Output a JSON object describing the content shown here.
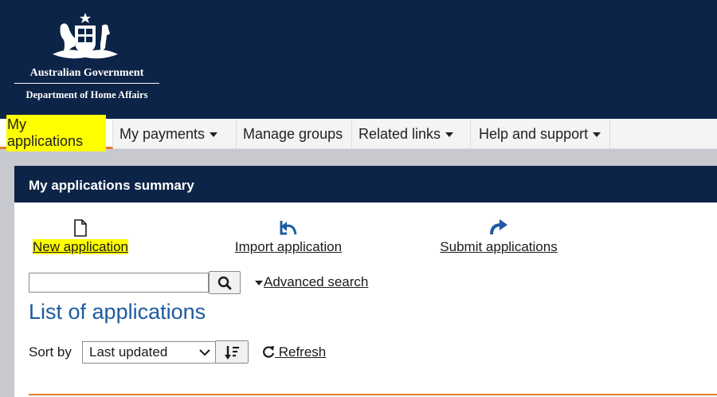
{
  "header": {
    "gov_line1": "Australian Government",
    "gov_line2": "Department of Home Affairs",
    "crest_icon": "commonwealth-coat-of-arms-icon"
  },
  "nav": {
    "items": [
      {
        "label": "My applications",
        "active": true,
        "dropdown": false
      },
      {
        "label": "My payments",
        "active": false,
        "dropdown": true
      },
      {
        "label": "Manage groups",
        "active": false,
        "dropdown": false
      },
      {
        "label": "Related links",
        "active": false,
        "dropdown": true
      },
      {
        "label": "Help and support",
        "active": false,
        "dropdown": true
      }
    ]
  },
  "panel": {
    "title": "My applications summary",
    "actions": {
      "new": {
        "label": "New application",
        "icon": "document-icon"
      },
      "import": {
        "label": "Import application",
        "icon": "import-arrow-icon"
      },
      "submit": {
        "label": "Submit applications",
        "icon": "forward-arrow-icon"
      }
    },
    "search": {
      "value": "",
      "placeholder": "",
      "button_icon": "search-icon"
    },
    "advanced_search": "Advanced search",
    "list_title": "List of applications",
    "sort": {
      "label": "Sort by",
      "selected": "Last updated",
      "order_icon": "sort-descending-icon"
    },
    "refresh": " Refresh"
  },
  "colors": {
    "header_bg": "#0c2447",
    "accent_orange": "#e37e2b",
    "link_blue": "#1e5ba0",
    "highlight": "#ffff00"
  }
}
